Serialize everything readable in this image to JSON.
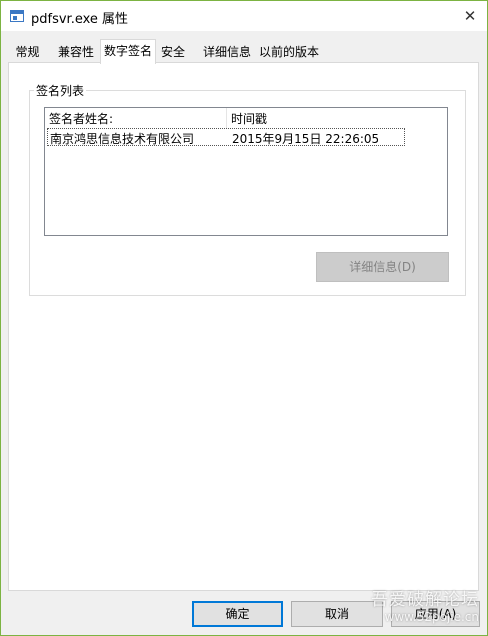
{
  "window": {
    "title": "pdfsvr.exe 属性",
    "close_glyph": "✕"
  },
  "tabs": [
    {
      "label": "常规"
    },
    {
      "label": "兼容性"
    },
    {
      "label": "数字签名"
    },
    {
      "label": "安全"
    },
    {
      "label": "详细信息"
    },
    {
      "label": "以前的版本"
    }
  ],
  "signature_list": {
    "group_label": "签名列表",
    "columns": [
      "签名者姓名:",
      "时间戳"
    ],
    "rows": [
      {
        "signer": "南京鸿思信息技术有限公司",
        "timestamp": "2015年9月15日 22:26:05"
      }
    ],
    "details_button": "详细信息(D)"
  },
  "buttons": {
    "ok": "确定",
    "cancel": "取消",
    "apply": "应用(A)"
  },
  "watermark": {
    "text": "吾爱破解论坛",
    "url": "www.52pojie.cn"
  },
  "colors": {
    "window_border": "#7cb342",
    "focus_blue": "#0078d7",
    "disabled_button": "#cccccc"
  }
}
